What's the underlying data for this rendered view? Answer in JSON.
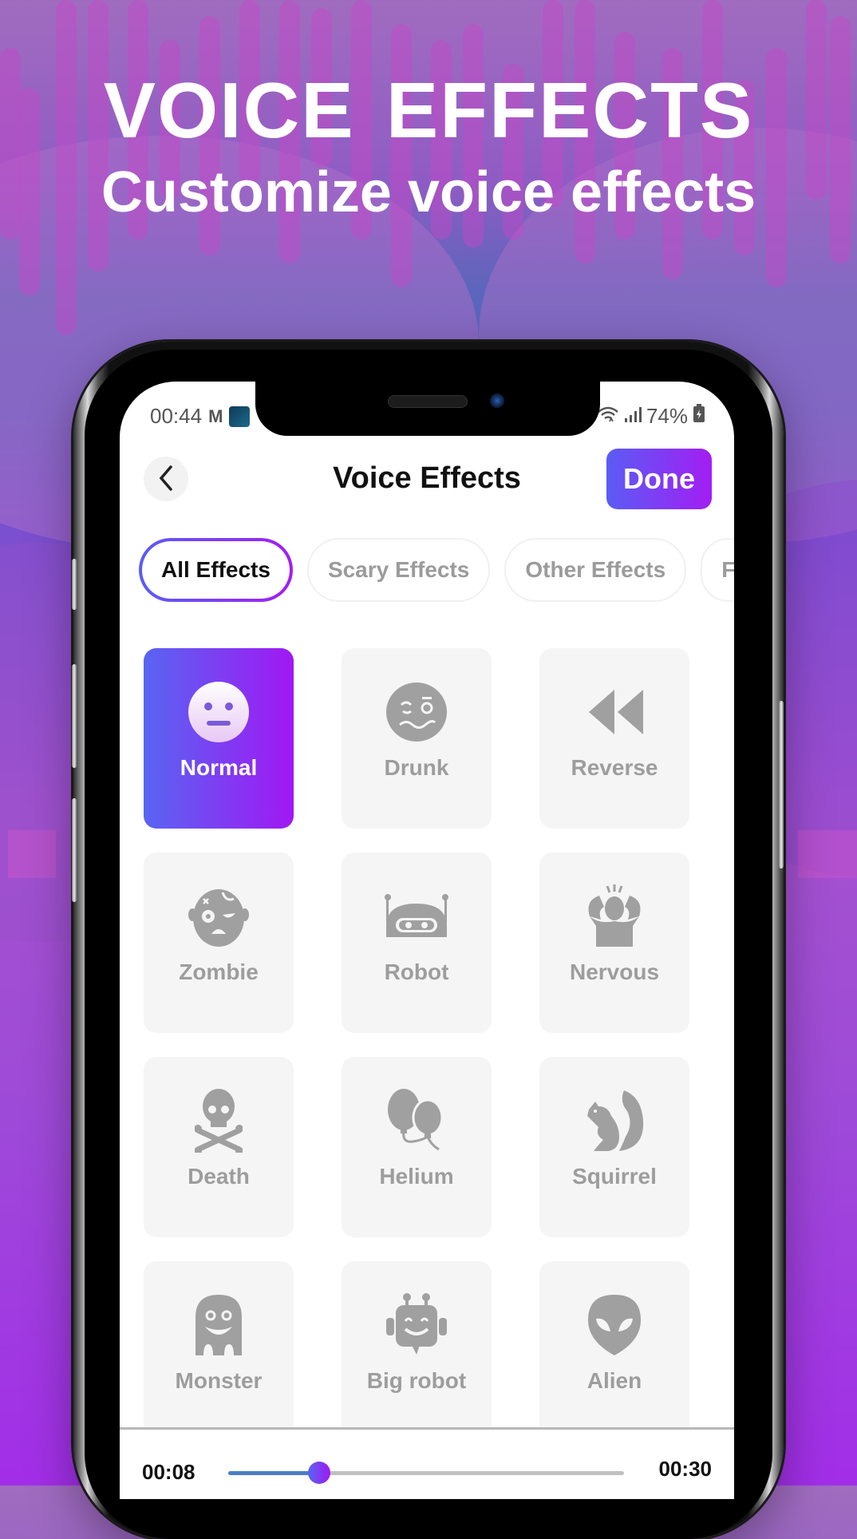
{
  "hero": {
    "title": "VOICE  EFFECTS",
    "subtitle": "Customize voice effects"
  },
  "status_bar": {
    "time": "00:44",
    "left_icons": [
      "gmail-icon",
      "app-thumbnail-icon"
    ],
    "right_icons": [
      "wifi-icon",
      "signal-icon",
      "battery-charging-icon"
    ],
    "battery": "74%"
  },
  "header": {
    "back_icon": "chevron-left-icon",
    "title": "Voice Effects",
    "done_label": "Done"
  },
  "tabs": [
    {
      "label": "All Effects",
      "active": true
    },
    {
      "label": "Scary Effects",
      "active": false
    },
    {
      "label": "Other Effects",
      "active": false
    },
    {
      "label": "F",
      "active": false
    }
  ],
  "effects": [
    {
      "label": "Normal",
      "icon": "neutral-face-icon",
      "selected": true
    },
    {
      "label": "Drunk",
      "icon": "woozy-face-icon",
      "selected": false
    },
    {
      "label": "Reverse",
      "icon": "rewind-icon",
      "selected": false
    },
    {
      "label": "Zombie",
      "icon": "zombie-icon",
      "selected": false
    },
    {
      "label": "Robot",
      "icon": "robot-icon",
      "selected": false
    },
    {
      "label": "Nervous",
      "icon": "nervous-person-icon",
      "selected": false
    },
    {
      "label": "Death",
      "icon": "skull-crossbones-icon",
      "selected": false
    },
    {
      "label": "Helium",
      "icon": "balloons-icon",
      "selected": false
    },
    {
      "label": "Squirrel",
      "icon": "squirrel-icon",
      "selected": false
    },
    {
      "label": "Monster",
      "icon": "ghost-monster-icon",
      "selected": false
    },
    {
      "label": "Big robot",
      "icon": "big-robot-icon",
      "selected": false
    },
    {
      "label": "Alien",
      "icon": "alien-icon",
      "selected": false
    }
  ],
  "player": {
    "current_time": "00:08",
    "total_time": "00:30",
    "progress": 0.23
  },
  "colors": {
    "accent_start": "#5865f2",
    "accent_end": "#a118f3",
    "inactive_text": "#9d9d9d",
    "card_bg": "#f5f5f5"
  }
}
